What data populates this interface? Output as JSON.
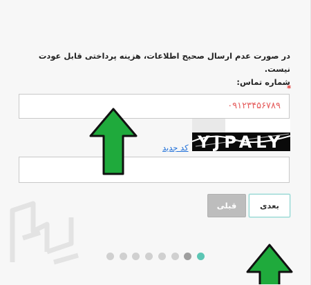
{
  "notice": {
    "line1": "در صورت عدم ارسال صحیح اطلاعات، هزینه پرداختی قابل عودت نیست.",
    "line2": "شماره تماس:"
  },
  "form": {
    "required_mark": "*",
    "phone_value": "۰۹۱۲۳۴۵۶۷۸۹",
    "captcha_text": "YJPALY",
    "new_code_label": "کد جدید",
    "captcha_value": ""
  },
  "buttons": {
    "next_label": "بعدی",
    "prev_label": "قبلی"
  },
  "pagination": {
    "total": 8,
    "active_index": 7,
    "active_color": "#5cc6b4",
    "completed_color": "#9e9e9e",
    "inactive_color": "#d0d0d0"
  },
  "annotation": {
    "arrow_color": "#1faa3c",
    "arrow_outline": "#111111"
  }
}
